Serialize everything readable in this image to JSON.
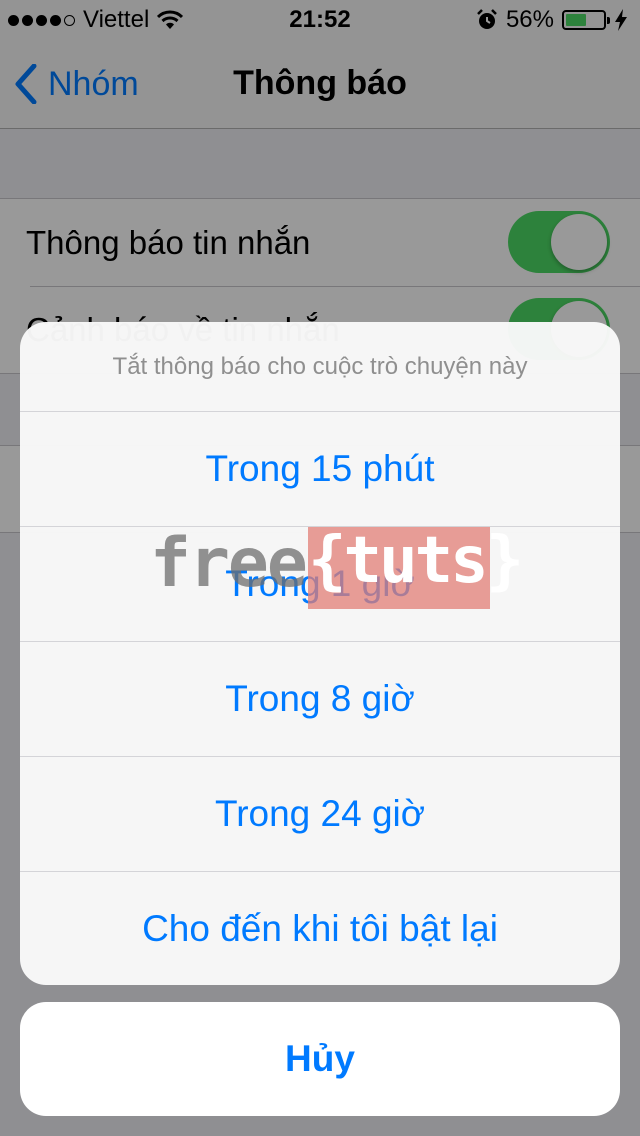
{
  "status_bar": {
    "carrier": "Viettel",
    "signal_dots_filled": 4,
    "signal_dots_total": 5,
    "time": "21:52",
    "battery_percent": "56%",
    "battery_level": 0.56,
    "icons": [
      "wifi-icon",
      "alarm-clock-icon",
      "battery-icon",
      "charging-bolt-icon"
    ]
  },
  "nav": {
    "back_label": "Nhóm",
    "title": "Thông báo"
  },
  "settings": {
    "rows": [
      {
        "label": "Thông báo tin nhắn",
        "toggle_on": true
      },
      {
        "label": "Cảnh báo về tin nhắn",
        "toggle_on": true
      }
    ]
  },
  "action_sheet": {
    "header": "Tắt thông báo cho cuộc trò chuyện này",
    "options": [
      "Trong 15 phút",
      "Trong 1 giờ",
      "Trong 8 giờ",
      "Trong 24 giờ",
      "Cho đến khi tôi bật lại"
    ],
    "cancel_label": "Hủy"
  },
  "watermark": {
    "part1": "free",
    "part2": "{tuts}"
  },
  "colors": {
    "accent": "#007aff",
    "toggle_on": "#4cd964",
    "watermark_box": "#e27d76"
  }
}
